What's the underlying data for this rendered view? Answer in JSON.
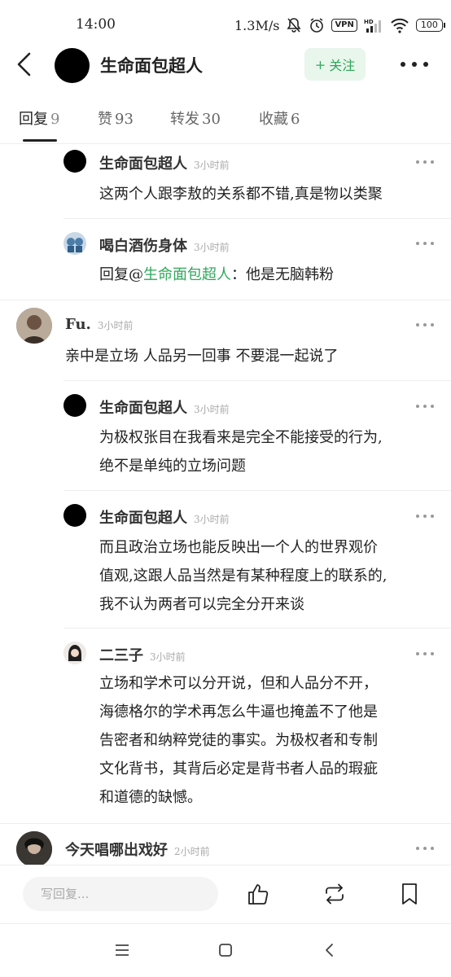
{
  "status_bar": {
    "time": "14:00",
    "speed": "1.3M/s",
    "vpn": "VPN",
    "battery": "100"
  },
  "header": {
    "title": "生命面包超人",
    "follow_label": "关注",
    "follow_plus": "+"
  },
  "tabs": [
    {
      "label": "回复",
      "count": "9",
      "active": true
    },
    {
      "label": "赞",
      "count": "93",
      "active": false
    },
    {
      "label": "转发",
      "count": "30",
      "active": false
    },
    {
      "label": "收藏",
      "count": "6",
      "active": false
    }
  ],
  "comments": [
    {
      "name": "生命面包超人",
      "time": "3小时前",
      "text": "这两个人跟李敖的关系都不错,真是物以类聚"
    },
    {
      "name": "喝白酒伤身体",
      "time": "3小时前",
      "reply_prefix": "回复@",
      "mention": "生命面包超人",
      "text": "：他是无脑韩粉"
    },
    {
      "name": "Fu.",
      "time": "3小时前",
      "text": "亲中是立场 人品另一回事 不要混一起说了"
    },
    {
      "name": "生命面包超人",
      "time": "3小时前",
      "lines": [
        "为极权张目在我看来是完全不能接受的行为,",
        "绝不是单纯的立场问题"
      ]
    },
    {
      "name": "生命面包超人",
      "time": "3小时前",
      "lines": [
        "而且政治立场也能反映出一个人的世界观价",
        "值观,这跟人品当然是有某种程度上的联系的,",
        "我不认为两者可以完全分开来谈"
      ]
    },
    {
      "name": "二三子",
      "time": "3小时前",
      "lines": [
        "立场和学术可以分开说，但和人品分不开，",
        "海德格尔的学术再怎么牛逼也掩盖不了他是",
        "告密者和纳粹党徒的事实。为极权者和专制",
        "文化背书，其背后必定是背书者人品的瑕疵",
        "和道德的缺憾。"
      ]
    },
    {
      "name": "今天唱哪出戏好",
      "time": "2小时前"
    }
  ],
  "bottom_bar": {
    "reply_placeholder": "写回复..."
  },
  "icons": {
    "back": "back-arrow-icon",
    "more": "more-dots-icon",
    "like": "thumbs-up-icon",
    "repost": "repost-icon",
    "bookmark": "bookmark-icon"
  },
  "colors": {
    "accent": "#2fa85a",
    "follow_bg": "#e9f6ec"
  }
}
